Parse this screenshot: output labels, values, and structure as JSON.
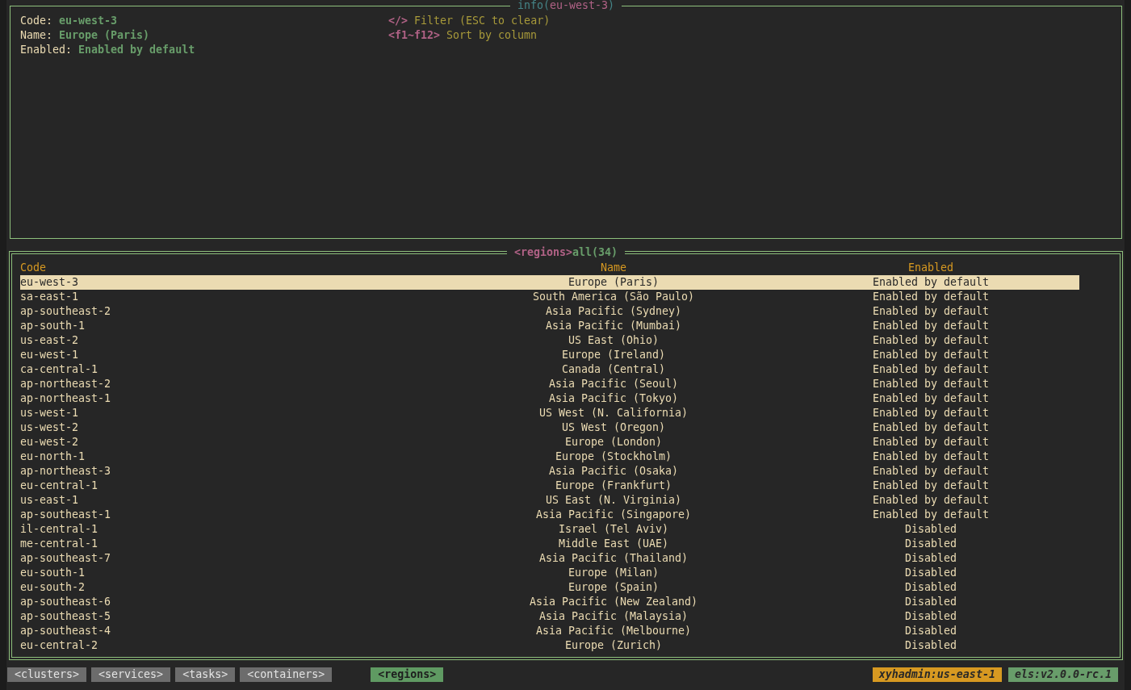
{
  "info_panel": {
    "title_parts": [
      {
        "text": "info(",
        "kind": "label"
      },
      {
        "text": "eu-west-3",
        "kind": "value"
      },
      {
        "text": ")",
        "kind": "label"
      }
    ],
    "fields": [
      {
        "label": "Code:",
        "value": "eu-west-3"
      },
      {
        "label": "Name:",
        "value": "Europe (Paris)"
      },
      {
        "label": "Enabled:",
        "value": "Enabled by default"
      }
    ],
    "shortcuts": [
      {
        "key": "</>",
        "description": "Filter (ESC to clear)"
      },
      {
        "key": "<f1~f12>",
        "description": "Sort by column"
      }
    ]
  },
  "regions_table": {
    "title_parts": [
      {
        "text": "<regions>",
        "kind": "view"
      },
      {
        "text": "all(34)",
        "kind": "filter"
      }
    ],
    "columns": [
      "Code",
      "Name",
      "Enabled"
    ],
    "rows": [
      {
        "cells": [
          "eu-west-3",
          "Europe (Paris)",
          "Enabled by default"
        ],
        "selected": true
      },
      {
        "cells": [
          "sa-east-1",
          "South America (São Paulo)",
          "Enabled by default"
        ],
        "selected": false
      },
      {
        "cells": [
          "ap-southeast-2",
          "Asia Pacific (Sydney)",
          "Enabled by default"
        ],
        "selected": false
      },
      {
        "cells": [
          "ap-south-1",
          "Asia Pacific (Mumbai)",
          "Enabled by default"
        ],
        "selected": false
      },
      {
        "cells": [
          "us-east-2",
          "US East (Ohio)",
          "Enabled by default"
        ],
        "selected": false
      },
      {
        "cells": [
          "eu-west-1",
          "Europe (Ireland)",
          "Enabled by default"
        ],
        "selected": false
      },
      {
        "cells": [
          "ca-central-1",
          "Canada (Central)",
          "Enabled by default"
        ],
        "selected": false
      },
      {
        "cells": [
          "ap-northeast-2",
          "Asia Pacific (Seoul)",
          "Enabled by default"
        ],
        "selected": false
      },
      {
        "cells": [
          "ap-northeast-1",
          "Asia Pacific (Tokyo)",
          "Enabled by default"
        ],
        "selected": false
      },
      {
        "cells": [
          "us-west-1",
          "US West (N. California)",
          "Enabled by default"
        ],
        "selected": false
      },
      {
        "cells": [
          "us-west-2",
          "US West (Oregon)",
          "Enabled by default"
        ],
        "selected": false
      },
      {
        "cells": [
          "eu-west-2",
          "Europe (London)",
          "Enabled by default"
        ],
        "selected": false
      },
      {
        "cells": [
          "eu-north-1",
          "Europe (Stockholm)",
          "Enabled by default"
        ],
        "selected": false
      },
      {
        "cells": [
          "ap-northeast-3",
          "Asia Pacific (Osaka)",
          "Enabled by default"
        ],
        "selected": false
      },
      {
        "cells": [
          "eu-central-1",
          "Europe (Frankfurt)",
          "Enabled by default"
        ],
        "selected": false
      },
      {
        "cells": [
          "us-east-1",
          "US East (N. Virginia)",
          "Enabled by default"
        ],
        "selected": false
      },
      {
        "cells": [
          "ap-southeast-1",
          "Asia Pacific (Singapore)",
          "Enabled by default"
        ],
        "selected": false
      },
      {
        "cells": [
          "il-central-1",
          "Israel (Tel Aviv)",
          "Disabled"
        ],
        "selected": false
      },
      {
        "cells": [
          "me-central-1",
          "Middle East (UAE)",
          "Disabled"
        ],
        "selected": false
      },
      {
        "cells": [
          "ap-southeast-7",
          "Asia Pacific (Thailand)",
          "Disabled"
        ],
        "selected": false
      },
      {
        "cells": [
          "eu-south-1",
          "Europe (Milan)",
          "Disabled"
        ],
        "selected": false
      },
      {
        "cells": [
          "eu-south-2",
          "Europe (Spain)",
          "Disabled"
        ],
        "selected": false
      },
      {
        "cells": [
          "ap-southeast-6",
          "Asia Pacific (New Zealand)",
          "Disabled"
        ],
        "selected": false
      },
      {
        "cells": [
          "ap-southeast-5",
          "Asia Pacific (Malaysia)",
          "Disabled"
        ],
        "selected": false
      },
      {
        "cells": [
          "ap-southeast-4",
          "Asia Pacific (Melbourne)",
          "Disabled"
        ],
        "selected": false
      },
      {
        "cells": [
          "eu-central-2",
          "Europe (Zurich)",
          "Disabled"
        ],
        "selected": false
      }
    ]
  },
  "footer": {
    "tabs": [
      {
        "label": "<clusters>",
        "kind": "resource",
        "selected": false
      },
      {
        "label": "<services>",
        "kind": "resource",
        "selected": false
      },
      {
        "label": "<tasks>",
        "kind": "resource",
        "selected": false
      },
      {
        "label": "<containers>",
        "kind": "resource",
        "selected": false
      },
      {
        "label": "<regions>",
        "kind": "view",
        "selected": true
      }
    ],
    "tags": [
      {
        "text": "xyhadmin:us-east-1",
        "kind": "profile"
      },
      {
        "text": "els:v2.0.0-rc.1",
        "kind": "version"
      }
    ]
  }
}
